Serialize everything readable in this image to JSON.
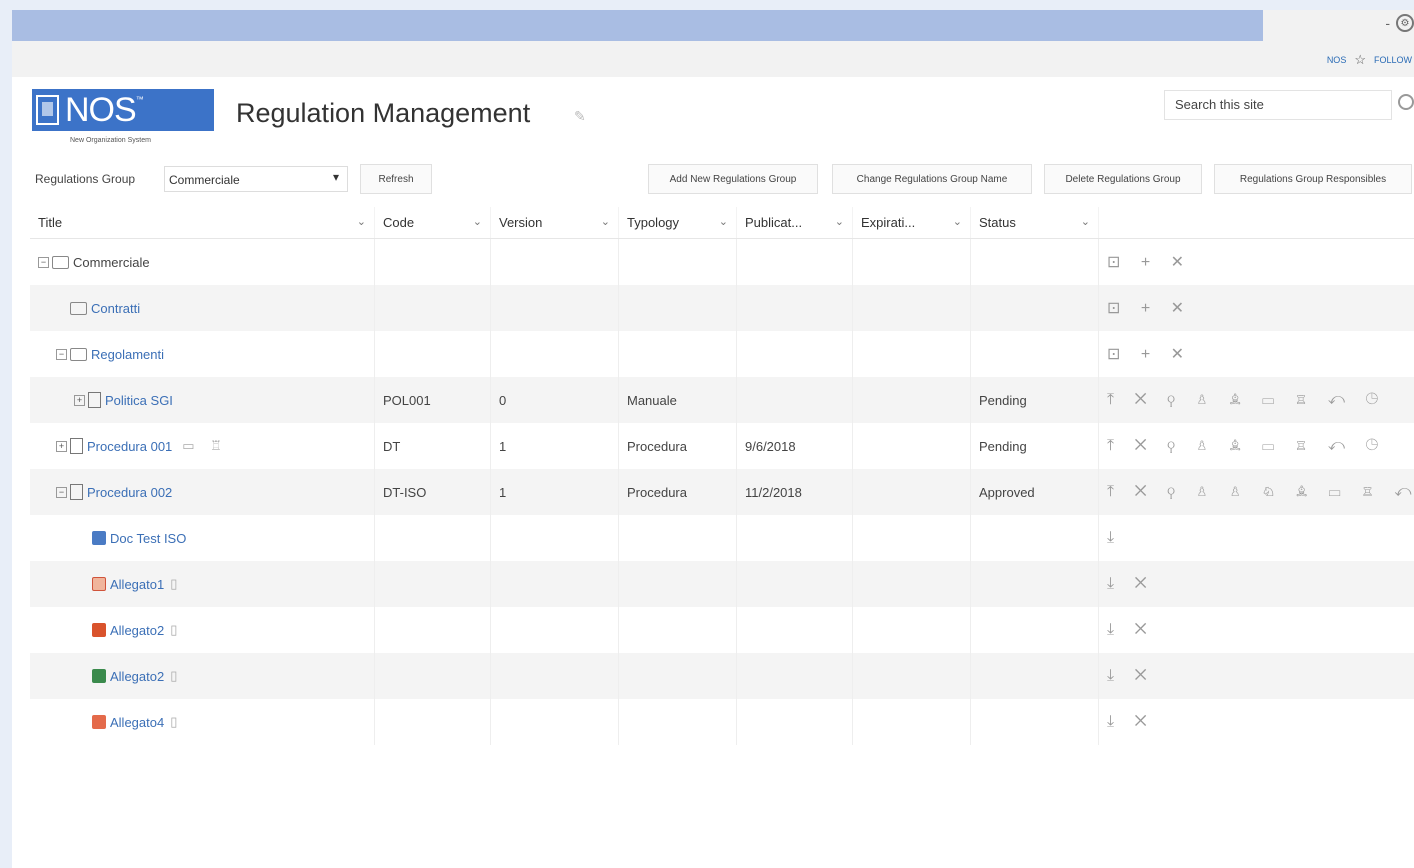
{
  "topbar": {
    "right_dash": "-"
  },
  "subbar": {
    "nos_link": "NOS",
    "follow_link": "FOLLOW"
  },
  "logo": {
    "text": "NOS",
    "tm": "™",
    "subtitle": "New Organization System"
  },
  "page": {
    "title": "Regulation Management"
  },
  "search": {
    "placeholder": "Search this site"
  },
  "toolbar": {
    "group_label": "Regulations Group",
    "group_value": "Commerciale",
    "refresh": "Refresh",
    "add_group": "Add New Regulations Group",
    "change_group_name": "Change Regulations Group Name",
    "delete_group": "Delete Regulations Group",
    "group_responsibles": "Regulations Group Responsibles"
  },
  "columns": [
    "Title",
    "Code",
    "Version",
    "Typology",
    "Publicat...",
    "Expirati...",
    "Status"
  ],
  "rows": [
    {
      "title": "Commerciale",
      "code": "",
      "version": "",
      "typology": "",
      "publication": "",
      "expiration": "",
      "status": "",
      "actions": "⊡ + ✕"
    },
    {
      "title": "Contratti",
      "code": "",
      "version": "",
      "typology": "",
      "publication": "",
      "expiration": "",
      "status": "",
      "actions": "⊡ + ✕"
    },
    {
      "title": "Regolamenti",
      "code": "",
      "version": "",
      "typology": "",
      "publication": "",
      "expiration": "",
      "status": "",
      "actions": "⊡ + ✕"
    },
    {
      "title": "Politica SGI",
      "code": "POL001",
      "version": "0",
      "typology": "Manuale",
      "publication": "",
      "expiration": "",
      "status": "Pending",
      "actions": "⤒ ✕ ⚲ ♙ ♗ ▭ ♖ ↶ ◷"
    },
    {
      "title": "Procedura 001",
      "code": "DT",
      "version": "1",
      "typology": "Procedura",
      "publication": "9/6/2018",
      "expiration": "",
      "status": "Pending",
      "actions": "⤒ ✕ ⚲ ♙ ♗ ▭ ♖ ↶ ◷"
    },
    {
      "title": "Procedura 002",
      "code": "DT-ISO",
      "version": "1",
      "typology": "Procedura",
      "publication": "11/2/2018",
      "expiration": "",
      "status": "Approved",
      "actions": "⤒ ✕ ⚲ ♙ ♙ ♘ ♗ ▭ ♖ ↶"
    },
    {
      "title": "Doc Test ISO",
      "code": "",
      "version": "",
      "typology": "",
      "publication": "",
      "expiration": "",
      "status": "",
      "actions": "⤓"
    },
    {
      "title": "Allegato1",
      "code": "",
      "version": "",
      "typology": "",
      "publication": "",
      "expiration": "",
      "status": "",
      "actions": "⤓ ✕"
    },
    {
      "title": "Allegato2",
      "code": "",
      "version": "",
      "typology": "",
      "publication": "",
      "expiration": "",
      "status": "",
      "actions": "⤓ ✕"
    },
    {
      "title": "Allegato2",
      "code": "",
      "version": "",
      "typology": "",
      "publication": "",
      "expiration": "",
      "status": "",
      "actions": "⤓ ✕"
    },
    {
      "title": "Allegato4",
      "code": "",
      "version": "",
      "typology": "",
      "publication": "",
      "expiration": "",
      "status": "",
      "actions": "⤓ ✕"
    }
  ]
}
